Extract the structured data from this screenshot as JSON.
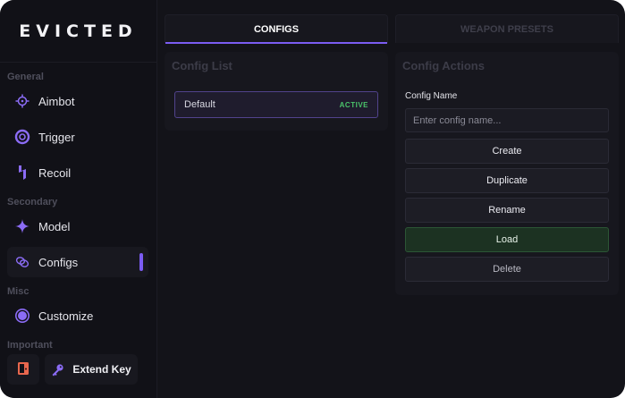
{
  "brand": "EVICTED",
  "sidebar": {
    "sections": [
      {
        "label": "General"
      },
      {
        "label": "Secondary"
      },
      {
        "label": "Misc"
      },
      {
        "label": "Important"
      }
    ],
    "items": [
      {
        "label": "Aimbot",
        "icon": "crosshair-icon"
      },
      {
        "label": "Trigger",
        "icon": "target-ring-icon"
      },
      {
        "label": "Recoil",
        "icon": "lightning-icon"
      },
      {
        "label": "Model",
        "icon": "sparkle-icon"
      },
      {
        "label": "Configs",
        "icon": "link-icon",
        "active": true
      },
      {
        "label": "Customize",
        "icon": "circle-icon"
      }
    ],
    "bottom": {
      "exit_icon": "door-exit-icon",
      "extend_label": "Extend Key",
      "extend_icon": "key-icon"
    }
  },
  "tabs": [
    {
      "label": "CONFIGS",
      "active": true
    },
    {
      "label": "WEAPON PRESETS",
      "active": false
    }
  ],
  "config_list": {
    "title": "Config List",
    "items": [
      {
        "name": "Default",
        "badge": "ACTIVE"
      }
    ]
  },
  "config_actions": {
    "title": "Config Actions",
    "name_label": "Config Name",
    "name_placeholder": "Enter config name...",
    "name_value": "",
    "buttons": {
      "create": "Create",
      "duplicate": "Duplicate",
      "rename": "Rename",
      "load": "Load",
      "delete": "Delete"
    }
  },
  "colors": {
    "accent": "#7b5cf2",
    "active_badge": "#4ac36a",
    "load_bg": "#1c3222",
    "exit_icon": "#e8674e"
  }
}
